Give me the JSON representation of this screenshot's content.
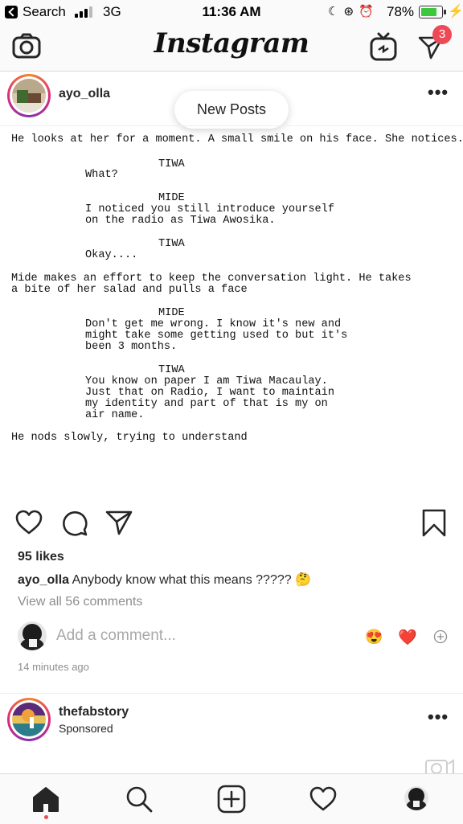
{
  "status_bar": {
    "back_app": "Search",
    "network": "3G",
    "time": "11:36 AM",
    "battery_pct": "78%",
    "battery_level": 0.78
  },
  "header": {
    "logo": "Instagram",
    "dm_badge": "3"
  },
  "post": {
    "username": "ayo_olla",
    "new_posts_pill": "New Posts",
    "screenplay": {
      "action1": "He looks at her for a moment. A small smile on his face. She notices.",
      "char1": "TIWA",
      "dlg1": "What?",
      "char2": "MIDE",
      "dlg2_l1": "I noticed you still introduce yourself",
      "dlg2_l2": "on the radio as Tiwa Awosika.",
      "char3": "TIWA",
      "dlg3": "Okay....",
      "action2_l1": "Mide makes an effort to keep the conversation light. He takes",
      "action2_l2": "a bite of her salad and pulls a face",
      "char4": "MIDE",
      "dlg4_l1": "Don't get me wrong. I know it's new and",
      "dlg4_l2": "might take some getting used to but it's",
      "dlg4_l3": "been 3 months.",
      "char5": "TIWA",
      "dlg5_l1": "You know on paper I am Tiwa Macaulay.",
      "dlg5_l2": "Just that on Radio, I want to maintain",
      "dlg5_l3": "my identity and part of that is my on",
      "dlg5_l4": "air name.",
      "action3": "He nods slowly, trying to understand"
    },
    "likes": "95 likes",
    "caption_user": "ayo_olla",
    "caption_text": "Anybody know what this means ????? 🤔",
    "view_comments": "View all 56 comments",
    "add_comment_placeholder": "Add a comment...",
    "quick_emoji_1": "😍",
    "quick_emoji_2": "❤️",
    "time_ago": "14 minutes ago"
  },
  "sponsored_post": {
    "username": "thefabstory",
    "label": "Sponsored"
  },
  "tab_bar": {
    "items": [
      "home",
      "search",
      "new-post",
      "activity",
      "profile"
    ]
  },
  "colors": {
    "badge": "#ed4956",
    "battery": "#3cc73c",
    "muted_text": "#8e8e8e"
  }
}
